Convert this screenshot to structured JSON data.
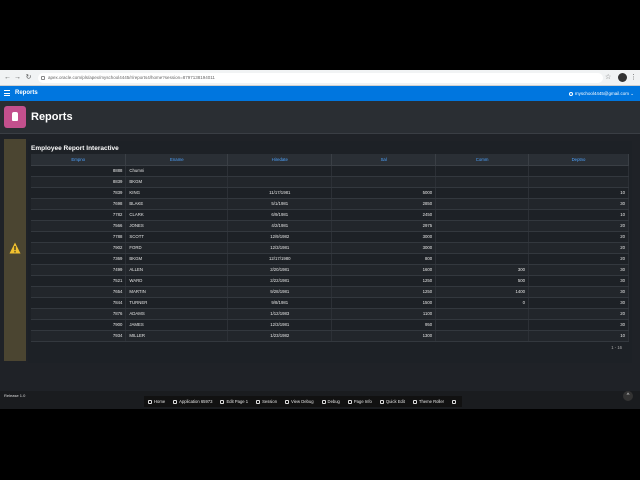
{
  "browser": {
    "url": "apex.oracle.com/pls/apex/myschool4445/r/reports4/home?session=8797138194011",
    "star_glyph": "☆",
    "menu_glyph": "⋮"
  },
  "app": {
    "name": "Reports",
    "user": "myschool4445@gmail.com",
    "user_caret": "⌄"
  },
  "page": {
    "title": "Reports"
  },
  "report": {
    "title": "Employee Report Interactive",
    "columns": [
      "Empno",
      "Ename",
      "Hiredate",
      "Sal",
      "Comm",
      "Deptno"
    ],
    "rows": [
      [
        "8888",
        "Chumni",
        "",
        "",
        "",
        ""
      ],
      [
        "8839",
        "BKGM",
        "",
        "",
        "",
        ""
      ],
      [
        "7839",
        "KING",
        "11/17/1981",
        "5000",
        "",
        "10"
      ],
      [
        "7698",
        "BLAKE",
        "5/1/1981",
        "2850",
        "",
        "30"
      ],
      [
        "7782",
        "CLARK",
        "6/9/1981",
        "2450",
        "",
        "10"
      ],
      [
        "7566",
        "JONES",
        "4/2/1981",
        "2975",
        "",
        "20"
      ],
      [
        "7788",
        "SCOTT",
        "12/9/1982",
        "3000",
        "",
        "20"
      ],
      [
        "7902",
        "FORD",
        "12/3/1981",
        "3000",
        "",
        "20"
      ],
      [
        "7369",
        "BKGM",
        "12/17/1980",
        "800",
        "",
        "20"
      ],
      [
        "7499",
        "ALLEN",
        "2/20/1981",
        "1600",
        "300",
        "30"
      ],
      [
        "7521",
        "WARD",
        "2/22/1981",
        "1250",
        "500",
        "30"
      ],
      [
        "7654",
        "MARTIN",
        "9/28/1981",
        "1250",
        "1400",
        "30"
      ],
      [
        "7844",
        "TURNER",
        "9/8/1981",
        "1500",
        "0",
        "30"
      ],
      [
        "7876",
        "ADAMS",
        "1/12/1983",
        "1100",
        "",
        "20"
      ],
      [
        "7900",
        "JAMES",
        "12/3/1981",
        "950",
        "",
        "30"
      ],
      [
        "7934",
        "MILLER",
        "1/23/1982",
        "1300",
        "",
        "10"
      ]
    ],
    "pagination": "1 - 16"
  },
  "footer": {
    "release": "Release 1.0",
    "scroll_top_glyph": "^",
    "toolbar": [
      {
        "label": "Home",
        "icon": "home-icon"
      },
      {
        "label": "Application 65973",
        "icon": "edit-icon"
      },
      {
        "label": "Edit Page 1",
        "icon": "edit-icon"
      },
      {
        "label": "Session",
        "icon": "session-icon"
      },
      {
        "label": "View Debug",
        "icon": "debug-icon"
      },
      {
        "label": "Debug",
        "icon": "bug-icon"
      },
      {
        "label": "Page Info",
        "icon": "info-icon"
      },
      {
        "label": "Quick Edit",
        "icon": "quick-edit-icon"
      },
      {
        "label": "Theme Roller",
        "icon": "theme-roller-icon"
      },
      {
        "label": "",
        "icon": "gear-icon"
      }
    ]
  },
  "colors": {
    "header_blue": "#0076df",
    "badge_pink": "#c3508d",
    "warning_yellow": "#f2c12e",
    "link_blue": "#4da3ff"
  }
}
